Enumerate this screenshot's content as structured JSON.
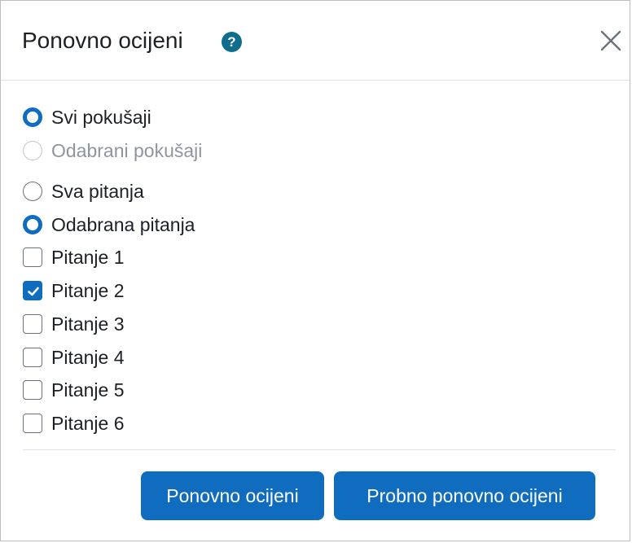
{
  "dialog": {
    "title": "Ponovno ocijeni",
    "help_icon_glyph": "?",
    "close_icon": "close-icon"
  },
  "attempts": [
    {
      "label": "Svi pokušaji",
      "checked": true,
      "disabled": false
    },
    {
      "label": "Odabrani pokušaji",
      "checked": false,
      "disabled": true
    }
  ],
  "questions_scope": [
    {
      "label": "Sva pitanja",
      "checked": false
    },
    {
      "label": "Odabrana pitanja",
      "checked": true
    }
  ],
  "questions": [
    {
      "label": "Pitanje 1",
      "checked": false
    },
    {
      "label": "Pitanje 2",
      "checked": true
    },
    {
      "label": "Pitanje 3",
      "checked": false
    },
    {
      "label": "Pitanje 4",
      "checked": false
    },
    {
      "label": "Pitanje 5",
      "checked": false
    },
    {
      "label": "Pitanje 6",
      "checked": false
    }
  ],
  "buttons": {
    "regrade": "Ponovno ocijeni",
    "dry_run": "Probno ponovno ocijeni"
  },
  "colors": {
    "primary": "#0f6cbf",
    "help": "#0f6e8c"
  }
}
